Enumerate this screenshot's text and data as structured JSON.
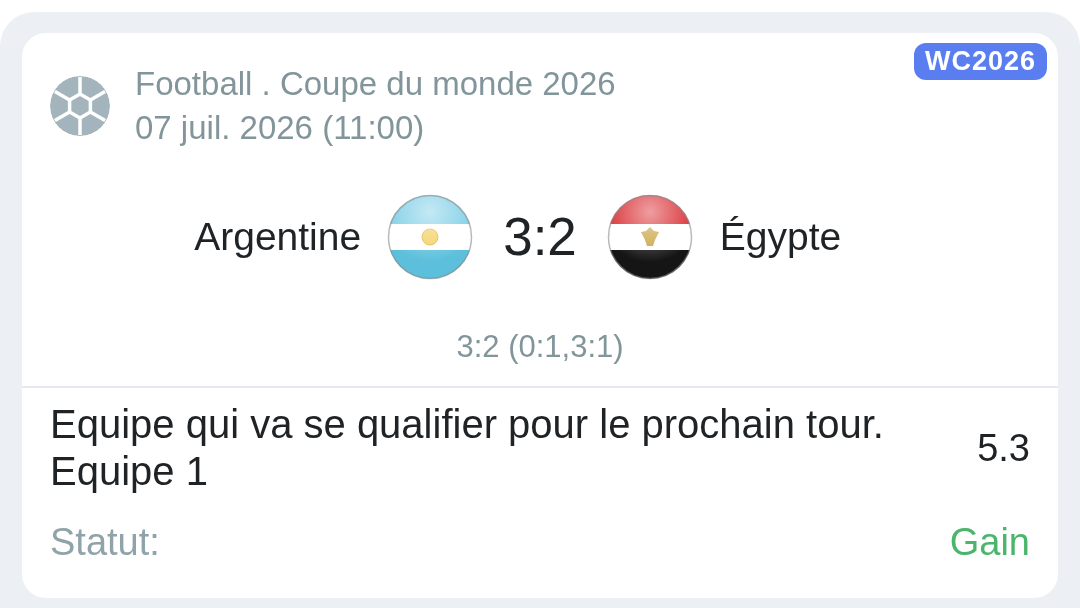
{
  "header": {
    "competition": "Football . Coupe du monde 2026",
    "date": "07 juil. 2026 (11:00)",
    "badge": "WC2026"
  },
  "match": {
    "teams": [
      {
        "name": "Argentine",
        "kind": "argentina"
      },
      {
        "name": "Égypte",
        "kind": "egypt"
      }
    ],
    "score": "3:2",
    "score_detail": "3:2 (0:1,3:1)"
  },
  "bet": {
    "market": "Equipe qui va se qualifier pour le prochain tour.",
    "outcome": "Equipe 1",
    "odds": "5.3",
    "status_label": "Statut:",
    "status": {
      "text": "Gain",
      "kind": "win"
    }
  }
}
